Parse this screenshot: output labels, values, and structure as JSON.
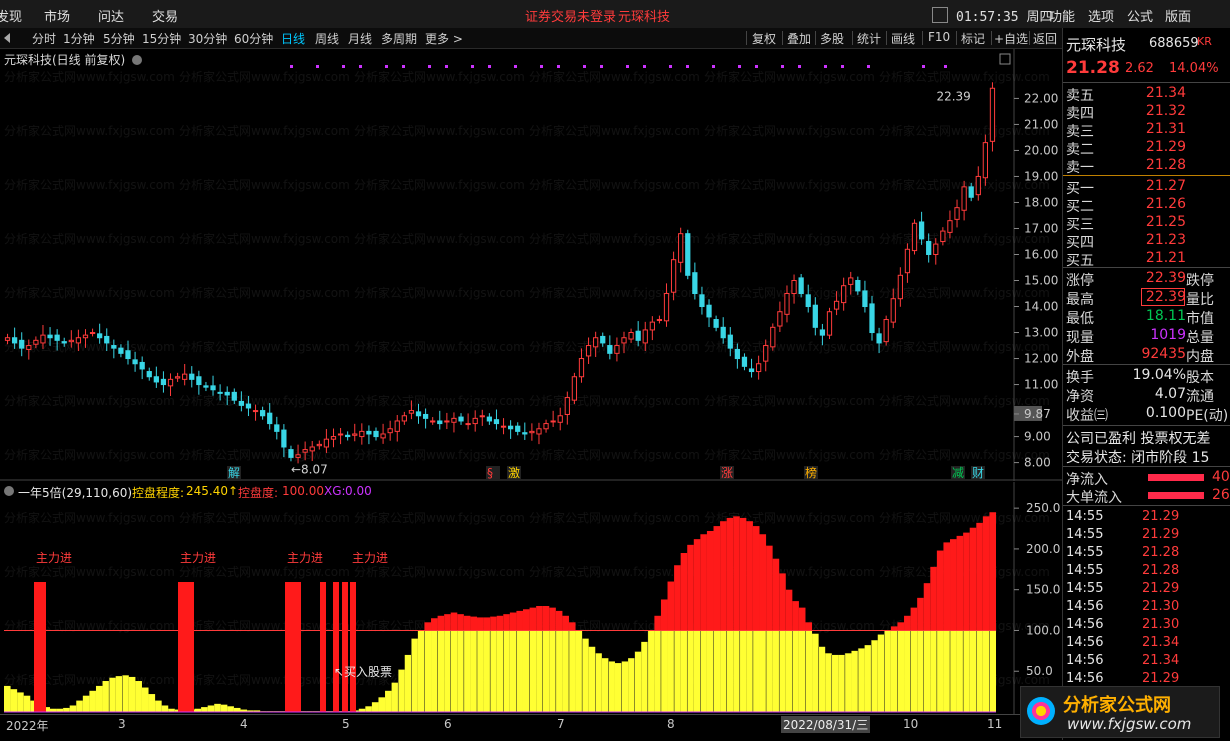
{
  "menu": {
    "items": [
      "发现",
      "市场",
      "问达",
      "交易"
    ],
    "notice": "证券交易未登录",
    "stock_name_top": "元琛科技",
    "time": "01:57:35 周四",
    "right": [
      "功能",
      "选项",
      "公式",
      "版面"
    ]
  },
  "periods": [
    "分时",
    "1分钟",
    "5分钟",
    "15分钟",
    "30分钟",
    "60分钟",
    "日线",
    "周线",
    "月线",
    "多周期",
    "更多 >"
  ],
  "active_period": "日线",
  "toolbar": [
    "复权",
    "叠加",
    "多股",
    "统计",
    "画线",
    "F10",
    "标记",
    "+自选",
    "返回"
  ],
  "chart_title": "元琛科技(日线 前复权)",
  "price_axis": [
    "22.00",
    "21.00",
    "20.00",
    "19.00",
    "18.00",
    "17.00",
    "16.00",
    "15.00",
    "14.00",
    "13.00",
    "12.00",
    "11.00",
    "9.87",
    "9.00",
    "8.00"
  ],
  "high_label": "22.39",
  "low_label": "8.07",
  "events": [
    "解",
    "§",
    "激",
    "涨",
    "榜",
    "减",
    "财"
  ],
  "watermark": "分析家公式网www.fxjgsw.com",
  "indicator": {
    "name": "一年5倍(29,110,60)",
    "l1_label": "控盘程度:",
    "l1_value": "245.40↑",
    "l2_label": "控盘度:",
    "l2_value": "100.00",
    "l3_label": "XG:",
    "l3_value": "0.00",
    "signal": "主力进",
    "note": "买入股票",
    "axis": [
      "250.0",
      "200.0",
      "150.0",
      "100.0",
      "50.0"
    ]
  },
  "date_axis": [
    "2022年",
    "3",
    "4",
    "5",
    "6",
    "7",
    "8",
    "2022/08/31/三",
    "10",
    "11"
  ],
  "chart_data": {
    "type": "candlestick",
    "title": "元琛科技(日线 前复权)",
    "ylim": [
      7.6,
      22.9
    ],
    "x_months": [
      "2022年",
      "3",
      "4",
      "5",
      "6",
      "7",
      "8",
      "9",
      "10",
      "11"
    ],
    "close": [
      12.8,
      12.6,
      12.4,
      12.5,
      12.7,
      12.9,
      12.8,
      12.7,
      12.6,
      12.7,
      12.8,
      12.9,
      13.0,
      12.8,
      12.6,
      12.4,
      12.2,
      12.0,
      11.8,
      11.6,
      11.3,
      11.1,
      11.0,
      11.2,
      11.3,
      11.4,
      11.2,
      11.0,
      10.9,
      10.8,
      10.7,
      10.6,
      10.4,
      10.2,
      10.1,
      10.0,
      9.8,
      9.5,
      9.2,
      8.6,
      8.2,
      8.3,
      8.5,
      8.6,
      8.7,
      8.9,
      9.0,
      9.1,
      9.0,
      9.1,
      9.2,
      9.1,
      9.0,
      9.1,
      9.3,
      9.6,
      9.8,
      10.0,
      9.8,
      9.7,
      9.6,
      9.5,
      9.6,
      9.7,
      9.6,
      9.5,
      9.7,
      9.8,
      9.6,
      9.5,
      9.4,
      9.3,
      9.2,
      9.1,
      9.2,
      9.3,
      9.5,
      9.6,
      9.8,
      10.5,
      11.3,
      12.0,
      12.5,
      12.8,
      12.6,
      12.2,
      12.5,
      12.8,
      13.0,
      12.7,
      13.1,
      13.4,
      13.5,
      14.5,
      15.8,
      16.8,
      15.2,
      14.5,
      14.0,
      13.6,
      13.2,
      12.8,
      12.4,
      12.0,
      11.7,
      11.5,
      11.8,
      12.5,
      13.2,
      13.8,
      14.5,
      15.0,
      14.5,
      14.0,
      13.2,
      12.9,
      13.8,
      14.2,
      14.8,
      15.1,
      14.6,
      14.0,
      13.0,
      12.6,
      13.5,
      14.3,
      15.2,
      16.2,
      17.2,
      16.6,
      16.0,
      16.4,
      16.9,
      17.3,
      17.8,
      18.6,
      18.2,
      19.0,
      20.3,
      22.39
    ]
  },
  "indicator_series": [
    32,
    28,
    24,
    20,
    14,
    9,
    6,
    4,
    4,
    5,
    8,
    14,
    20,
    26,
    32,
    38,
    42,
    44,
    45,
    43,
    38,
    30,
    22,
    14,
    8,
    4,
    3,
    2,
    3,
    4,
    6,
    8,
    10,
    9,
    7,
    5,
    3,
    2,
    2,
    1,
    1,
    1,
    1,
    1,
    1,
    1,
    1,
    1,
    1,
    1,
    1,
    1,
    1,
    2,
    4,
    7,
    12,
    18,
    26,
    36,
    52,
    70,
    90,
    100,
    110,
    115,
    118,
    120,
    122,
    120,
    118,
    117,
    116,
    116,
    117,
    118,
    120,
    122,
    124,
    126,
    128,
    130,
    130,
    128,
    124,
    118,
    110,
    100,
    90,
    80,
    72,
    66,
    62,
    60,
    62,
    66,
    74,
    86,
    100,
    118,
    138,
    160,
    180,
    195,
    205,
    212,
    218,
    222,
    228,
    234,
    238,
    240,
    238,
    234,
    228,
    218,
    204,
    188,
    170,
    150,
    136,
    128,
    110,
    96,
    80,
    72,
    70,
    70,
    72,
    75,
    78,
    82,
    88,
    95,
    100,
    105,
    110,
    118,
    128,
    140,
    158,
    178,
    198,
    208,
    212,
    216,
    220,
    226,
    232,
    240,
    245
  ],
  "quote": {
    "name": "元琛科技",
    "code": "688659",
    "tag": "KR",
    "price": "21.28",
    "change": "2.62",
    "pct": "14.04%",
    "asks": [
      [
        "卖五",
        "21.34"
      ],
      [
        "卖四",
        "21.32"
      ],
      [
        "卖三",
        "21.31"
      ],
      [
        "卖二",
        "21.29"
      ],
      [
        "卖一",
        "21.28"
      ]
    ],
    "bids": [
      [
        "买一",
        "21.27"
      ],
      [
        "买二",
        "21.26"
      ],
      [
        "买三",
        "21.25"
      ],
      [
        "买四",
        "21.23"
      ],
      [
        "买五",
        "21.21"
      ]
    ],
    "stats": [
      [
        "涨停",
        "22.39",
        "跌停"
      ],
      [
        "最高",
        "22.39",
        "量比"
      ],
      [
        "最低",
        "18.11",
        "市值"
      ],
      [
        "现量",
        "1019",
        "总量"
      ],
      [
        "外盘",
        "92435",
        "内盘"
      ]
    ],
    "stats2": [
      [
        "换手",
        "19.04%",
        "股本"
      ],
      [
        "净资",
        "4.07",
        "流通"
      ],
      [
        "收益㈢",
        "0.100",
        "PE(动)"
      ]
    ],
    "company": "公司已盈利 投票权无差",
    "trade_state": "交易状态: 闭市阶段 15",
    "flows": [
      [
        "净流入",
        "40"
      ],
      [
        "大单流入",
        "26"
      ]
    ],
    "ticks": [
      [
        "14:55",
        "21.29"
      ],
      [
        "14:55",
        "21.29"
      ],
      [
        "14:55",
        "21.28"
      ],
      [
        "14:55",
        "21.28"
      ],
      [
        "14:55",
        "21.29"
      ],
      [
        "14:56",
        "21.30"
      ],
      [
        "14:56",
        "21.30"
      ],
      [
        "14:56",
        "21.34"
      ],
      [
        "14:56",
        "21.34"
      ],
      [
        "14:56",
        "21.29"
      ]
    ]
  },
  "logo": {
    "cn": "分析家公式网",
    "url": "www.fxjgsw.com"
  }
}
